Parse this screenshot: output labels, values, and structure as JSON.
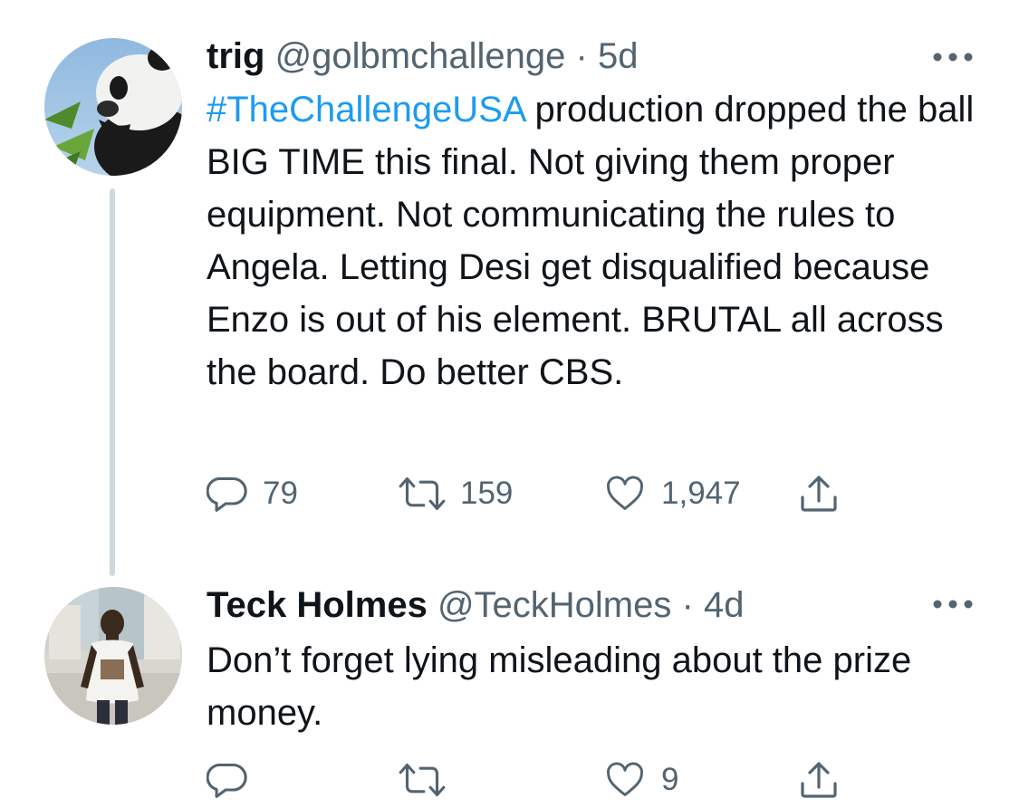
{
  "tweets": [
    {
      "author_name": "trig",
      "handle": "@golbmchallenge",
      "separator": "·",
      "time": "5d",
      "hashtag": "#TheChallengeUSA",
      "text": "production dropped the ball BIG TIME this final. Not giving them proper equipment. Not communicating the rules to Angela. Letting Desi get disqualified because Enzo is out of his element. BRUTAL all across the board. Do better CBS.",
      "replies": "79",
      "retweets": "159",
      "likes": "1,947",
      "avatar_icon": "panda-avatar",
      "actions_icons": [
        "reply-icon",
        "retweet-icon",
        "like-icon",
        "share-icon"
      ]
    },
    {
      "author_name": "Teck Holmes",
      "handle": "@TeckHolmes",
      "separator": "·",
      "time": "4d",
      "text": "Don’t forget lying misleading about the prize money.",
      "likes": "9",
      "avatar_icon": "person-photo-avatar",
      "actions_icons": [
        "reply-icon",
        "retweet-icon",
        "like-icon",
        "share-icon"
      ]
    }
  ],
  "colors": {
    "accent": "#1d9bf0",
    "text": "#0f1419",
    "secondary": "#536471",
    "thread_line": "#cfd9de"
  }
}
